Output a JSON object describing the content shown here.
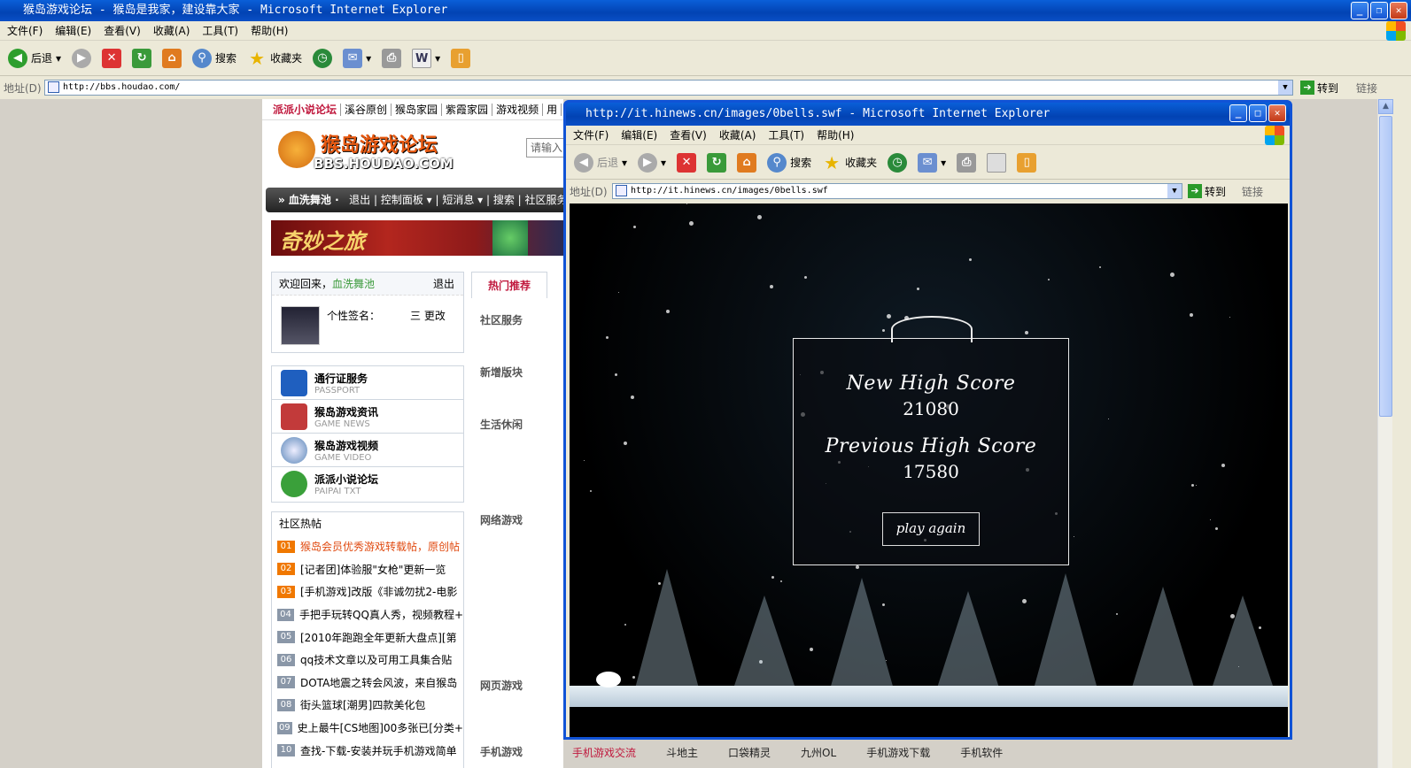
{
  "outer": {
    "title": "猴岛游戏论坛 - 猴岛是我家，建设靠大家 - Microsoft Internet Explorer",
    "menu": [
      "文件(F)",
      "编辑(E)",
      "查看(V)",
      "收藏(A)",
      "工具(T)",
      "帮助(H)"
    ],
    "toolbar": {
      "back": "后退",
      "search": "搜索",
      "favorites": "收藏夹"
    },
    "address_label": "地址(D)",
    "address": "http://bbs.houdao.com/",
    "go": "转到",
    "links": "链接"
  },
  "forum": {
    "top_links": [
      "派派小说论坛",
      "溪谷原创",
      "猴岛家园",
      "紫霞家园",
      "游戏视频",
      "用"
    ],
    "logo_text": "猴岛游戏论坛",
    "logo_sub": "BBS.HOUDAO.COM",
    "search_placeholder": "请输入",
    "nav": [
      "» 血洗舞池 ·",
      "退出",
      "控制面板 ▾",
      "短消息 ▾",
      "搜索",
      "社区服务"
    ],
    "banner_text": "奇妙之旅",
    "welcome": "欢迎回来，",
    "username": "血洗舞池",
    "logout": "退出",
    "signature_label": "个性签名：",
    "signature_edit": "三 更改",
    "services": [
      {
        "title": "通行证服务",
        "sub": "PASSPORT",
        "color": "#1f5fbf"
      },
      {
        "title": "猴岛游戏资讯",
        "sub": "GAME NEWS",
        "color": "#c23a3a"
      },
      {
        "title": "猴岛游戏视频",
        "sub": "GAME VIDEO",
        "color": "#5a86b8"
      },
      {
        "title": "派派小说论坛",
        "sub": "PAIPAI TXT",
        "color": "#3aa03a"
      }
    ],
    "hot_title": "社区热帖",
    "hot_posts": [
      {
        "num": "01",
        "text": "猴岛会员优秀游戏转载帖，原创帖"
      },
      {
        "num": "02",
        "text": "[记者团]体验服\"女枪\"更新一览"
      },
      {
        "num": "03",
        "text": "[手机游戏]改版《非诚勿扰2-电影"
      },
      {
        "num": "04",
        "text": "手把手玩转QQ真人秀，视频教程+"
      },
      {
        "num": "05",
        "text": "[2010年跑跑全年更新大盘点][第"
      },
      {
        "num": "06",
        "text": "qq技术文章以及可用工具集合贴"
      },
      {
        "num": "07",
        "text": "DOTA地震之转会风波，来自猴岛"
      },
      {
        "num": "08",
        "text": "街头篮球[潮男]四款美化包"
      },
      {
        "num": "09",
        "text": "史上最牛[CS地图]00多张已[分类+"
      },
      {
        "num": "10",
        "text": "查找-下载-安装并玩手机游戏简单"
      }
    ],
    "hot_tab": "热门推荐",
    "categories": [
      "社区服务",
      "新增版块",
      "生活休闲",
      "网络游戏",
      "网页游戏",
      "手机游戏"
    ]
  },
  "popup": {
    "title": "http://it.hinews.cn/images/0bells.swf - Microsoft Internet Explorer",
    "menu": [
      "文件(F)",
      "编辑(E)",
      "查看(V)",
      "收藏(A)",
      "工具(T)",
      "帮助(H)"
    ],
    "toolbar": {
      "back": "后退",
      "search": "搜索",
      "favorites": "收藏夹"
    },
    "address_label": "地址(D)",
    "address": "http://it.hinews.cn/images/0bells.swf",
    "go": "转到",
    "links": "链接"
  },
  "game": {
    "new_high_label": "New High Score",
    "new_high_value": "21080",
    "prev_high_label": "Previous High Score",
    "prev_high_value": "17580",
    "play_again": "play again"
  },
  "bottom_links": [
    "手机游戏交流",
    "斗地主",
    "口袋精灵",
    "九州OL",
    "手机游戏下载",
    "手机软件"
  ]
}
